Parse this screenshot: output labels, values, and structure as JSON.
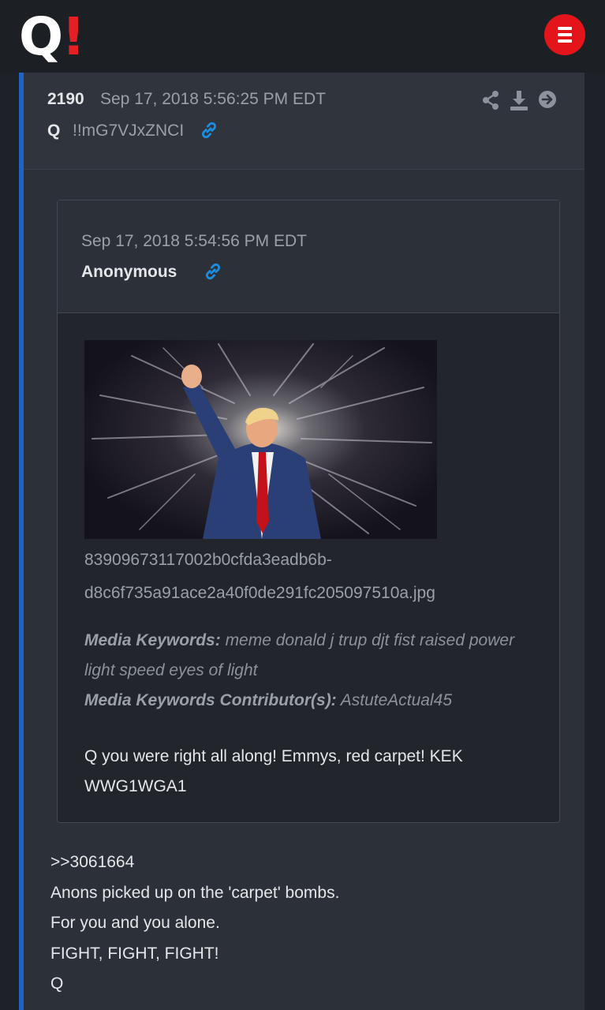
{
  "header": {
    "logo_q": "Q",
    "logo_bang": "!",
    "menu_icon": "hamburger-icon"
  },
  "post": {
    "number": "2190",
    "date": "Sep 17, 2018 5:56:25 PM EDT",
    "author": "Q",
    "tripcode": "!!mG7VJxZNCI",
    "actions": [
      "share-icon",
      "download-icon",
      "next-arrow-icon"
    ]
  },
  "quoted": {
    "date": "Sep 17, 2018 5:54:56 PM EDT",
    "author": "Anonymous",
    "filename_line1": "83909673117002b0cfda3eadb6b-",
    "filename_line2": "d8c6f735a91ace2a40f0de291fc205097510a.jpg",
    "keywords_label": "Media Keywords:",
    "keywords": "meme donald j trup djt fist raised power light speed eyes of light",
    "contributors_label": "Media Keywords Contributor(s):",
    "contributors": "AstuteActual45",
    "text_line1": "Q you were right all along! Emmys, red carpet! KEK",
    "text_line2": "WWG1WGA1"
  },
  "body": {
    "lines": [
      ">>3061664",
      "Anons picked up on the 'carpet' bombs.",
      "For you and you alone.",
      "FIGHT, FIGHT, FIGHT!",
      "Q"
    ]
  },
  "colors": {
    "accent_red": "#e3151b",
    "accent_blue": "#1f64c4",
    "link_blue": "#1a8ee0"
  }
}
